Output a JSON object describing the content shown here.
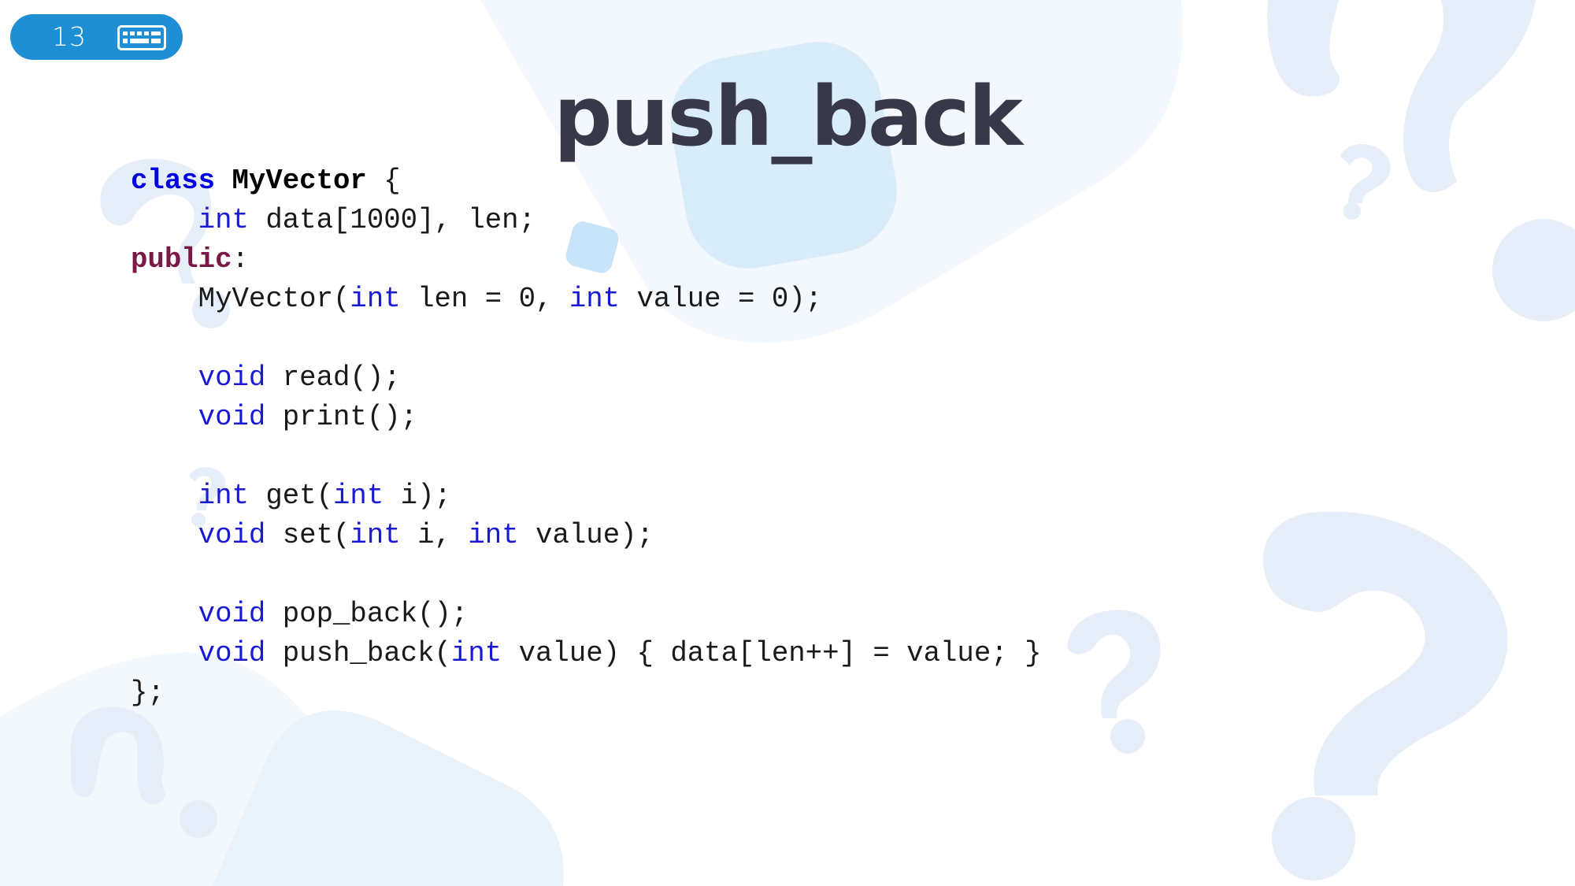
{
  "slide": {
    "number": "13",
    "badge_icon": "keyboard-icon",
    "title": "push_back"
  },
  "colors": {
    "badge": "#1e8fd5",
    "title": "#383848",
    "keyword": "#0000e0",
    "type": "#1a1ad4",
    "access_specifier": "#7a1848",
    "decor_light": "#e6eff9"
  },
  "code": {
    "lines": [
      [
        {
          "t": "class",
          "c": "kw"
        },
        {
          "t": " "
        },
        {
          "t": "MyVector",
          "c": "name"
        },
        {
          "t": " {"
        }
      ],
      [
        {
          "t": "    "
        },
        {
          "t": "int",
          "c": "type"
        },
        {
          "t": " data[1000], len;"
        }
      ],
      [
        {
          "t": "public",
          "c": "access"
        },
        {
          "t": ":"
        }
      ],
      [
        {
          "t": "    MyVector("
        },
        {
          "t": "int",
          "c": "type"
        },
        {
          "t": " len = 0, "
        },
        {
          "t": "int",
          "c": "type"
        },
        {
          "t": " value = 0);"
        }
      ],
      [],
      [
        {
          "t": "    "
        },
        {
          "t": "void",
          "c": "type"
        },
        {
          "t": " read();"
        }
      ],
      [
        {
          "t": "    "
        },
        {
          "t": "void",
          "c": "type"
        },
        {
          "t": " print();"
        }
      ],
      [],
      [
        {
          "t": "    "
        },
        {
          "t": "int",
          "c": "type"
        },
        {
          "t": " get("
        },
        {
          "t": "int",
          "c": "type"
        },
        {
          "t": " i);"
        }
      ],
      [
        {
          "t": "    "
        },
        {
          "t": "void",
          "c": "type"
        },
        {
          "t": " set("
        },
        {
          "t": "int",
          "c": "type"
        },
        {
          "t": " i, "
        },
        {
          "t": "int",
          "c": "type"
        },
        {
          "t": " value);"
        }
      ],
      [],
      [
        {
          "t": "    "
        },
        {
          "t": "void",
          "c": "type"
        },
        {
          "t": " pop_back();"
        }
      ],
      [
        {
          "t": "    "
        },
        {
          "t": "void",
          "c": "type"
        },
        {
          "t": " push_back("
        },
        {
          "t": "int",
          "c": "type"
        },
        {
          "t": " value) { data[len++] = value; }"
        }
      ],
      [
        {
          "t": "};"
        }
      ]
    ]
  }
}
